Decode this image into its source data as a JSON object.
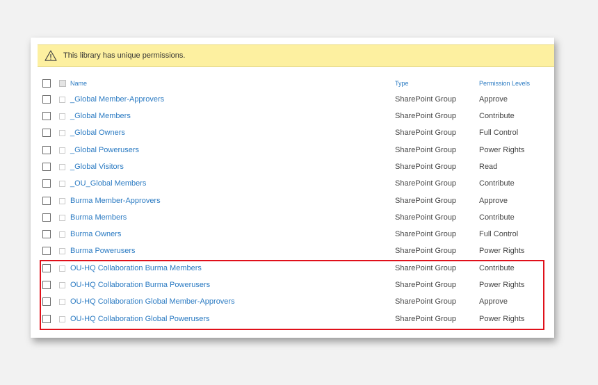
{
  "banner": {
    "icon": "warning-triangle-icon",
    "text": "This library has unique permissions.",
    "background": "#fdf0a0"
  },
  "table": {
    "headers": {
      "name": "Name",
      "type": "Type",
      "permission_levels": "Permission Levels"
    },
    "rows": [
      {
        "name": "_Global Member-Approvers",
        "type": "SharePoint Group",
        "permission": "Approve"
      },
      {
        "name": "_Global Members",
        "type": "SharePoint Group",
        "permission": "Contribute"
      },
      {
        "name": "_Global Owners",
        "type": "SharePoint Group",
        "permission": "Full Control"
      },
      {
        "name": "_Global Powerusers",
        "type": "SharePoint Group",
        "permission": "Power Rights"
      },
      {
        "name": "_Global Visitors",
        "type": "SharePoint Group",
        "permission": "Read"
      },
      {
        "name": "_OU_Global Members",
        "type": "SharePoint Group",
        "permission": "Contribute"
      },
      {
        "name": "Burma Member-Approvers",
        "type": "SharePoint Group",
        "permission": "Approve"
      },
      {
        "name": "Burma Members",
        "type": "SharePoint Group",
        "permission": "Contribute"
      },
      {
        "name": "Burma Owners",
        "type": "SharePoint Group",
        "permission": "Full Control"
      },
      {
        "name": "Burma Powerusers",
        "type": "SharePoint Group",
        "permission": "Power Rights"
      },
      {
        "name": "OU-HQ Collaboration Burma Members",
        "type": "SharePoint Group",
        "permission": "Contribute",
        "highlighted": true
      },
      {
        "name": "OU-HQ Collaboration Burma Powerusers",
        "type": "SharePoint Group",
        "permission": "Power Rights",
        "highlighted": true
      },
      {
        "name": "OU-HQ Collaboration Global Member-Approvers",
        "type": "SharePoint Group",
        "permission": "Approve",
        "highlighted": true
      },
      {
        "name": "OU-HQ Collaboration Global Powerusers",
        "type": "SharePoint Group",
        "permission": "Power Rights",
        "highlighted": true
      }
    ]
  },
  "colors": {
    "link": "#2a7ac2",
    "highlight_border": "#e0101a"
  }
}
